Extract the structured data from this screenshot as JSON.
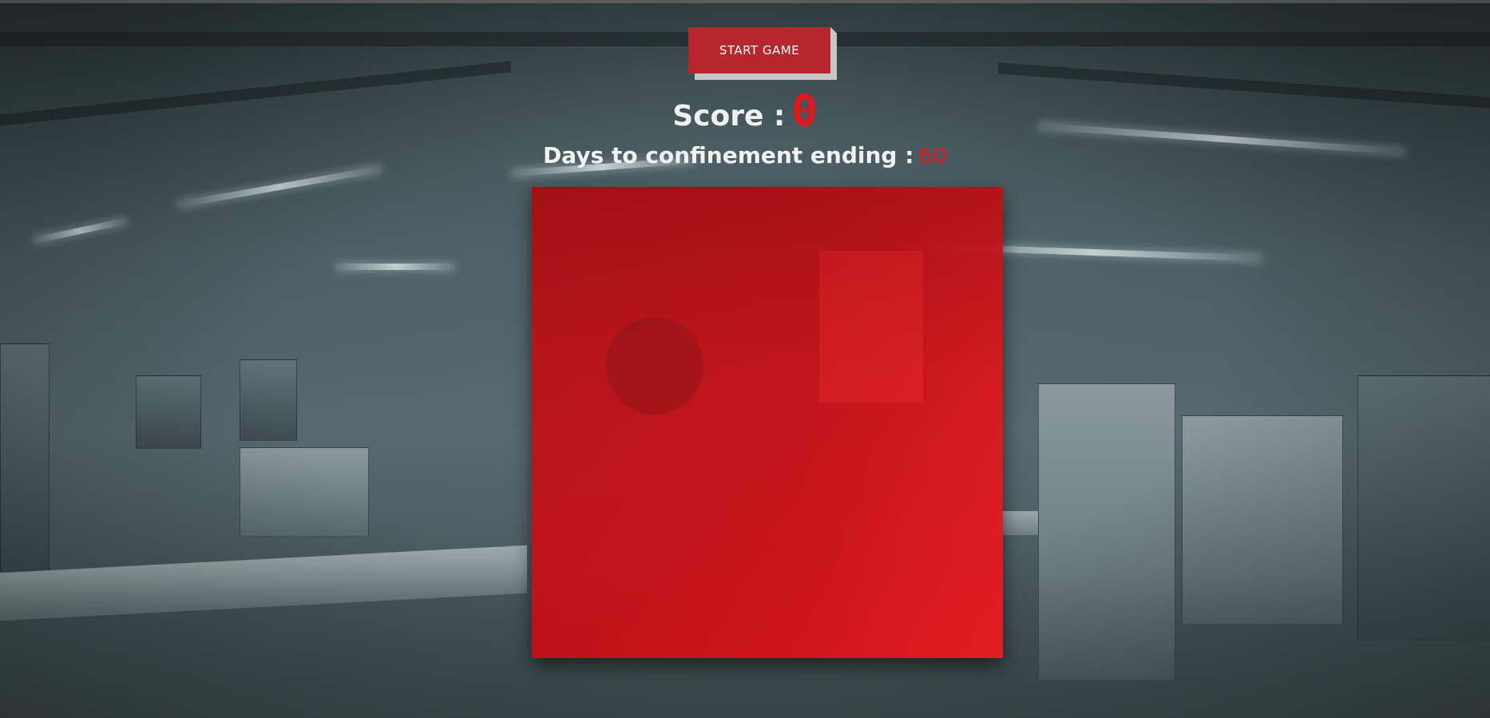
{
  "game": {
    "start_button_label": "START GAME",
    "score_label": "Score :",
    "score_value": "0",
    "days_label": "Days to confinement ending :",
    "days_value": "60"
  },
  "colors": {
    "accent_red": "#e8141b",
    "button_red": "#b8262d",
    "board_red": "#cc0c12",
    "text_light": "#f1f1f1"
  },
  "background": {
    "scene": "laboratory"
  }
}
